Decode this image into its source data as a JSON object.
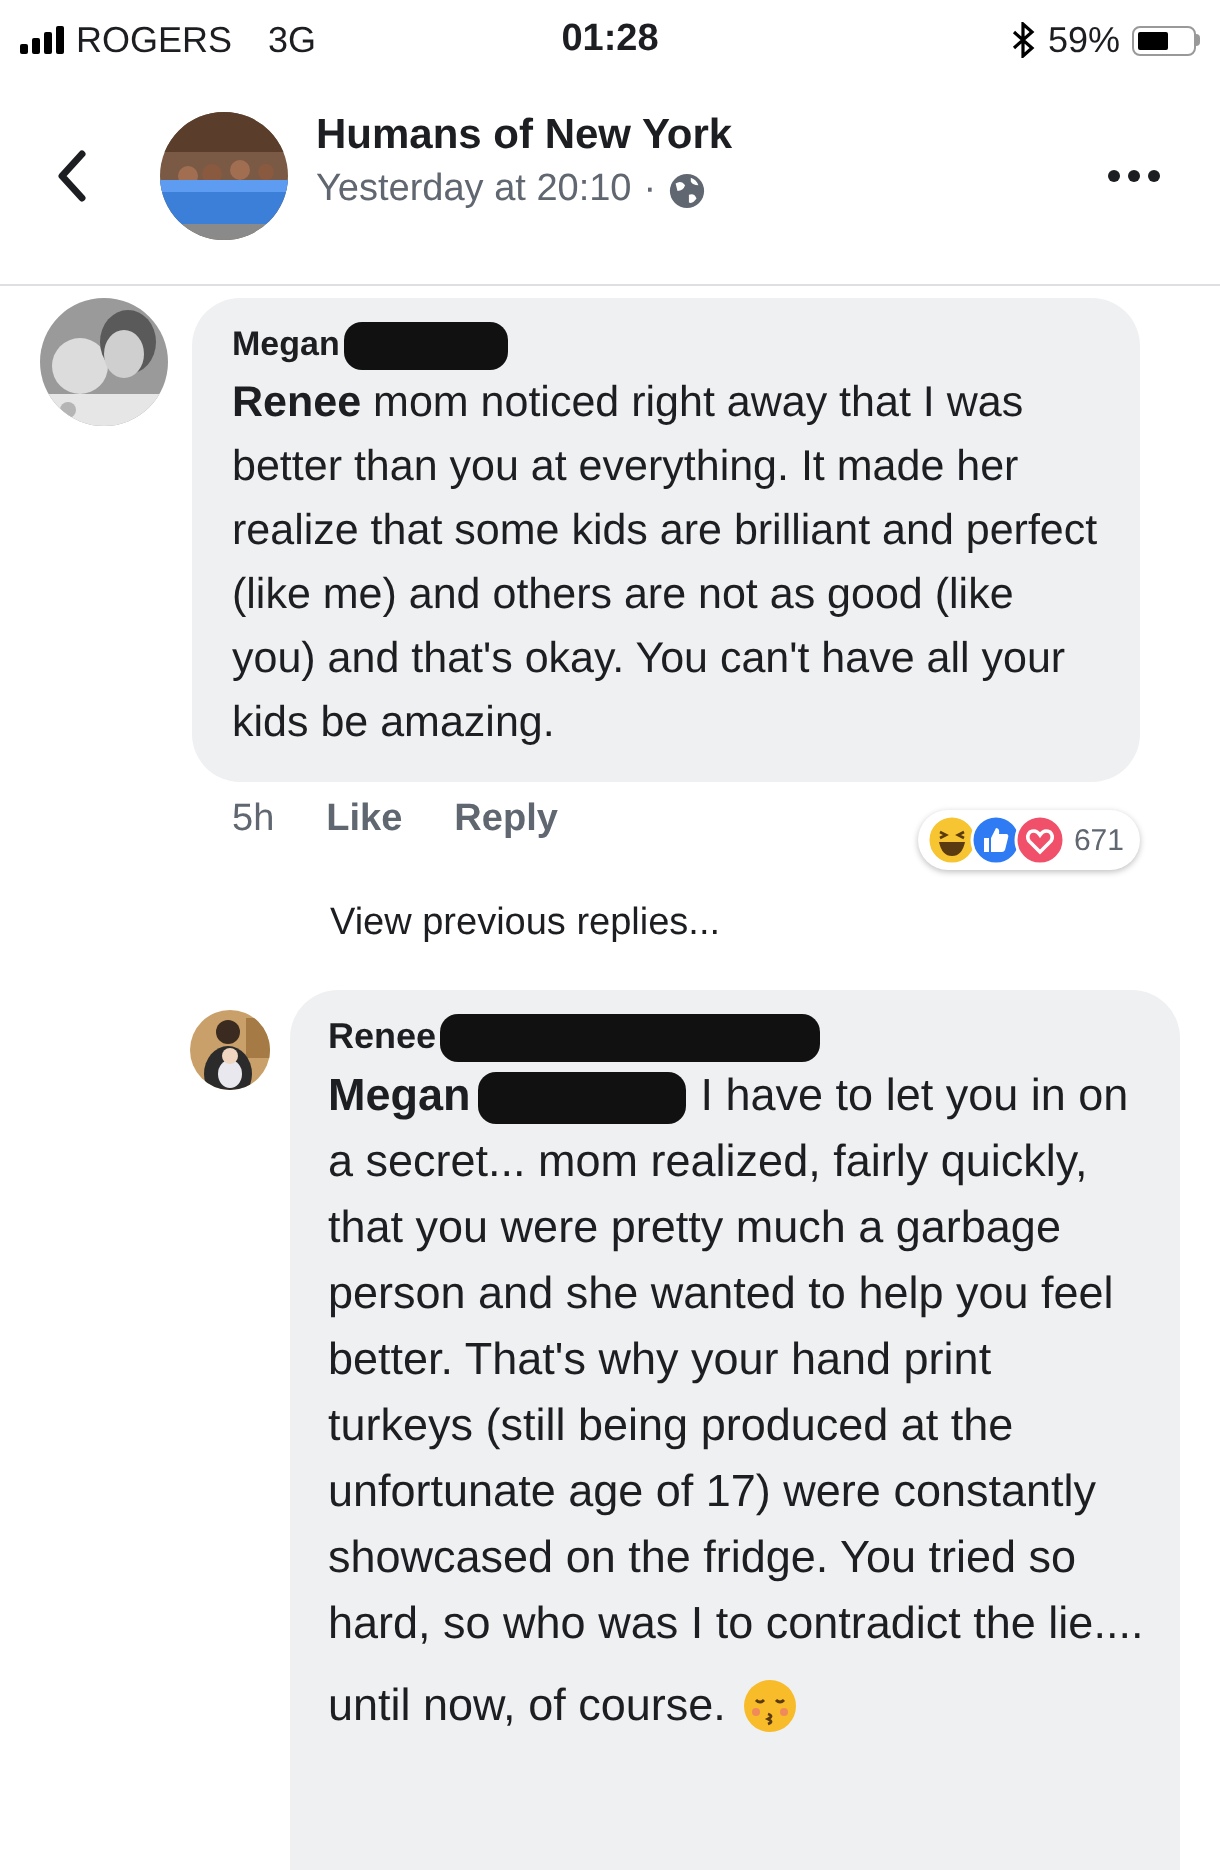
{
  "status_bar": {
    "carrier": "ROGERS",
    "network": "3G",
    "time": "01:28",
    "battery": "59%"
  },
  "header": {
    "page_name": "Humans of New York",
    "timestamp": "Yesterday at 20:10",
    "separator": "·"
  },
  "comment": {
    "author": "Megan",
    "author_redacted": true,
    "mention": "Renee",
    "paragraphs": [
      "mom noticed right away that I was better than you at everything. It made her realize that some kids are brilliant and perfect (like me) and others are not as good (like you) and that's okay. You can't have all your kids be amazing."
    ],
    "time": "5h",
    "actions": [
      "Like",
      "Reply"
    ],
    "reaction_count": "671"
  },
  "view_previous": "View previous replies...",
  "reply": {
    "author": "Renee",
    "author_redacted": true,
    "mention": "Megan",
    "mention_redacted": true,
    "paragraphs": [
      "I have to let you in on a secret... mom realized, fairly quickly, that you were pretty much a garbage person and she wanted to help you feel better. That's why your hand print turkeys (still being produced at the unfortunate age of 17) were constantly showcased on the fridge. You tried so hard, so who was I to contradict the lie....",
      "until now, of course."
    ]
  }
}
